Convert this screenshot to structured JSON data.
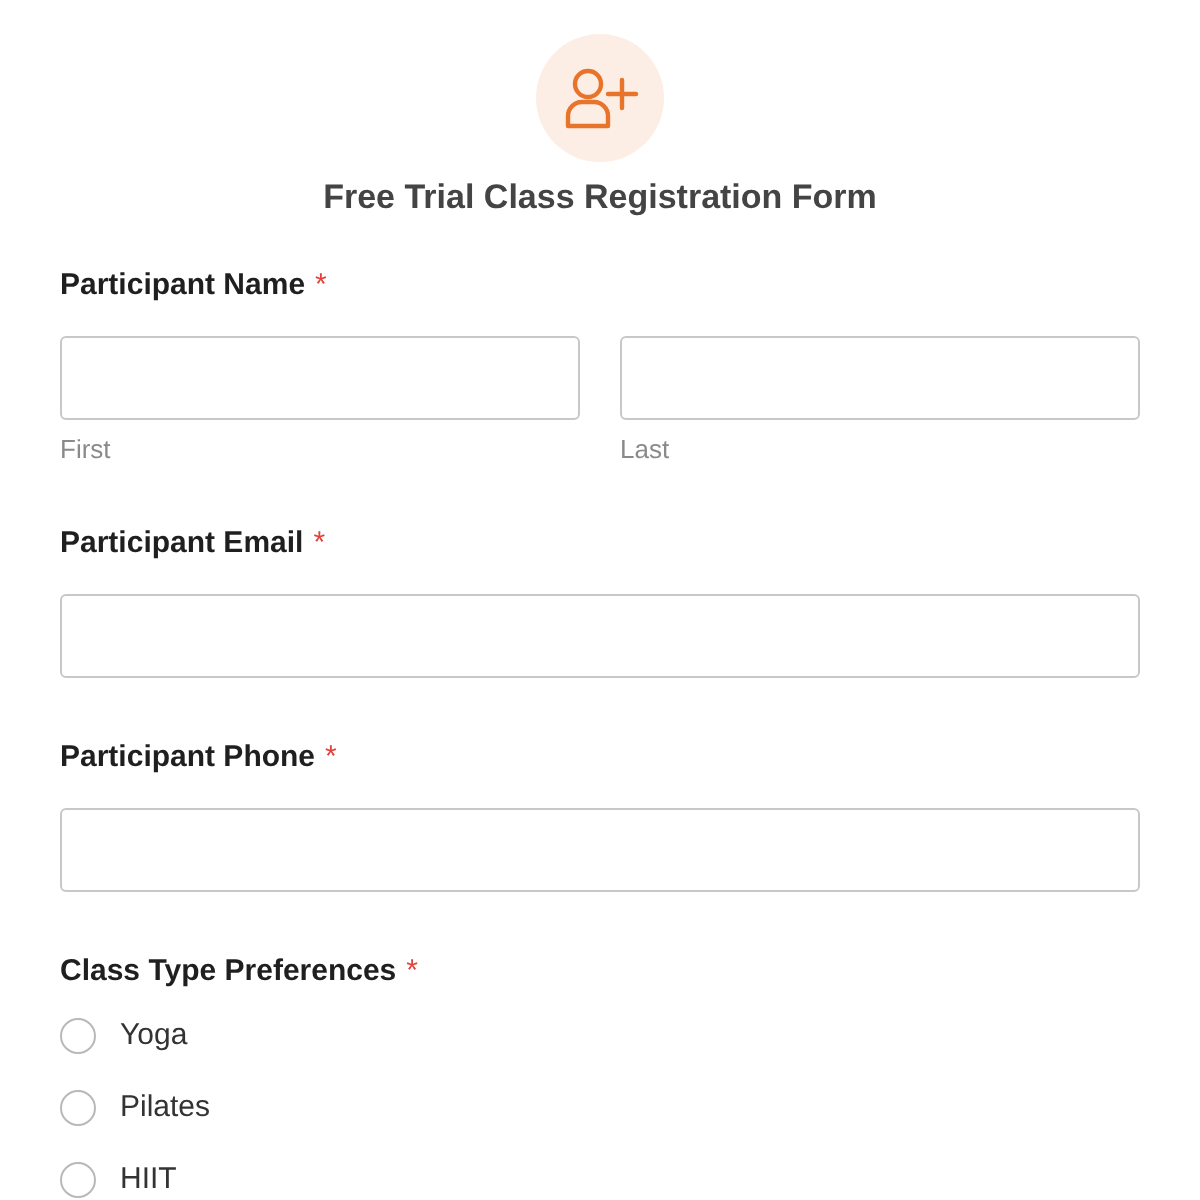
{
  "header": {
    "title": "Free Trial Class Registration Form"
  },
  "fields": [
    {
      "kind": "name",
      "label": "Participant Name",
      "required_mark": "*",
      "subfields": [
        {
          "sublabel": "First"
        },
        {
          "sublabel": "Last"
        }
      ]
    },
    {
      "kind": "text",
      "label": "Participant Email",
      "required_mark": "*"
    },
    {
      "kind": "text",
      "label": "Participant Phone",
      "required_mark": "*"
    },
    {
      "kind": "radio",
      "label": "Class Type Preferences",
      "required_mark": "*",
      "options": [
        {
          "label": "Yoga",
          "selected": false
        },
        {
          "label": "Pilates",
          "selected": false
        },
        {
          "label": "HIIT",
          "selected": false
        }
      ]
    }
  ]
}
